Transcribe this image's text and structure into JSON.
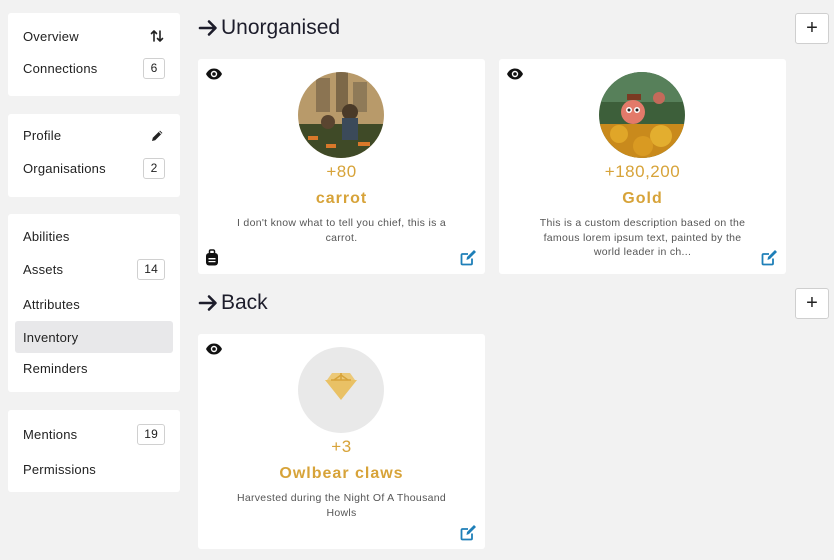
{
  "sidebar": {
    "groups": [
      {
        "items": [
          {
            "label": "Overview",
            "icon": "sort-arrows-icon"
          },
          {
            "label": "Connections",
            "count": "6"
          }
        ]
      },
      {
        "items": [
          {
            "label": "Profile",
            "icon": "pencil-icon"
          },
          {
            "label": "Organisations",
            "count": "2"
          }
        ]
      },
      {
        "items": [
          {
            "label": "Abilities"
          },
          {
            "label": "Assets",
            "count": "14"
          },
          {
            "label": "Attributes"
          },
          {
            "label": "Inventory",
            "active": true
          },
          {
            "label": "Reminders"
          }
        ]
      },
      {
        "items": [
          {
            "label": "Mentions",
            "count": "19"
          },
          {
            "label": "Permissions"
          }
        ]
      }
    ]
  },
  "sections": [
    {
      "title": "Unorganised",
      "add_label": "+",
      "cards": [
        {
          "amount": "+80",
          "name": "carrot",
          "description": "I don't know what to tell you chief, this is a carrot.",
          "has_bag_icon": true
        },
        {
          "amount": "+180,200",
          "name": "Gold",
          "description": "This is a custom description based on the famous lorem ipsum text, painted by the world leader in ch...",
          "has_bag_icon": false
        }
      ]
    },
    {
      "title": "Back",
      "add_label": "+",
      "cards": [
        {
          "amount": "+3",
          "name": "Owlbear claws",
          "description": "Harvested during the Night Of A Thousand Howls",
          "has_bag_icon": false
        }
      ]
    }
  ],
  "colors": {
    "accent": "#d7a339",
    "edit": "#1e7fb8",
    "active_bg": "#e8e8ea"
  }
}
